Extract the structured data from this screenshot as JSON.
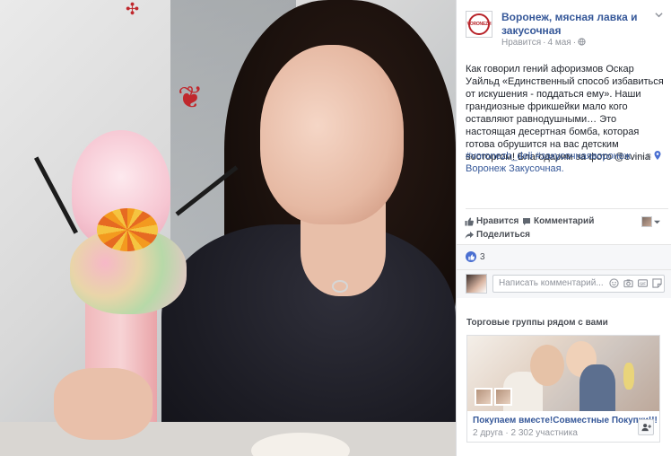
{
  "post": {
    "page_name": "Воронеж, мясная лавка и закусочная",
    "logo_text": "VORONEZH",
    "meta_like": "Нравится",
    "meta_date": "4 мая",
    "body": "Как говорил гений афоризмов Оскар Уайльд «Единственный способ избавиться от искушения - поддаться ему». Наши грандиозные фрикшейки мало кого оставляют равнодушными… Это настоящая десертная бомба, которая готова обрушится на вас детским восторгом! Благодарим за фото @evinia",
    "tag1": "#voronezh_deli",
    "tag2": "#закусочнаяворонеж",
    "tag_sep": " — в ",
    "location": "Воронеж Закусочная."
  },
  "actions": {
    "like": "Нравится",
    "comment": "Комментарий",
    "share": "Поделиться"
  },
  "likes": {
    "count": "3"
  },
  "comment_box": {
    "placeholder": "Написать комментарий..."
  },
  "groups": {
    "title": "Торговые группы рядом с вами",
    "card_title": "Покупаем вместе!Совместные Покупки!!!",
    "card_meta": "2 друга · 2 302 участника"
  },
  "colors": {
    "link": "#365899",
    "like_blue": "#4a6fd1",
    "brand_red": "#b8242a"
  },
  "icons": [
    "thumbs-up-icon",
    "comment-icon",
    "share-icon",
    "globe-icon",
    "chevron-down-icon",
    "smile-icon",
    "camera-icon",
    "gif-icon",
    "sticker-icon",
    "location-pin-icon",
    "add-member-icon"
  ]
}
